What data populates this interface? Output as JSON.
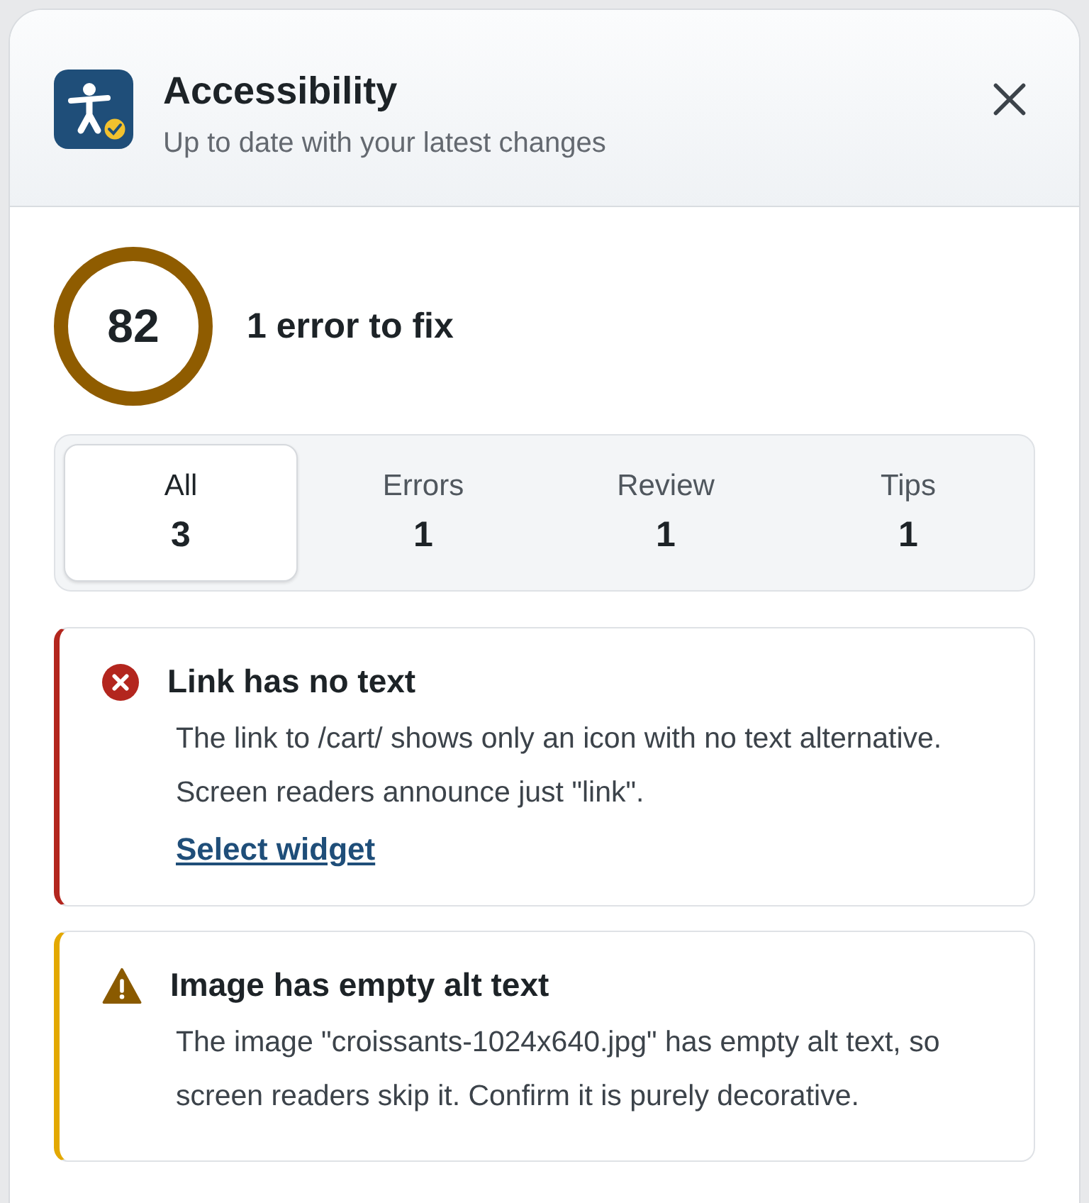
{
  "header": {
    "title": "Accessibility",
    "subtitle": "Up to date with your latest changes"
  },
  "score": {
    "value": "82",
    "summary": "1 error to fix"
  },
  "tabs": [
    {
      "label": "All",
      "count": "3",
      "selected": true
    },
    {
      "label": "Errors",
      "count": "1",
      "selected": false
    },
    {
      "label": "Review",
      "count": "1",
      "selected": false
    },
    {
      "label": "Tips",
      "count": "1",
      "selected": false
    }
  ],
  "issues": [
    {
      "kind": "error",
      "title": "Link has no text",
      "description": "The link to /cart/ shows only an icon with no text alternative. Screen readers announce just \"link\".",
      "link": "Select widget"
    },
    {
      "kind": "warning",
      "title": "Image has empty alt text",
      "description": "The image \"croissants-1024x640.jpg\" has empty alt text, so screen readers skip it. Confirm it is purely decorative."
    }
  ]
}
